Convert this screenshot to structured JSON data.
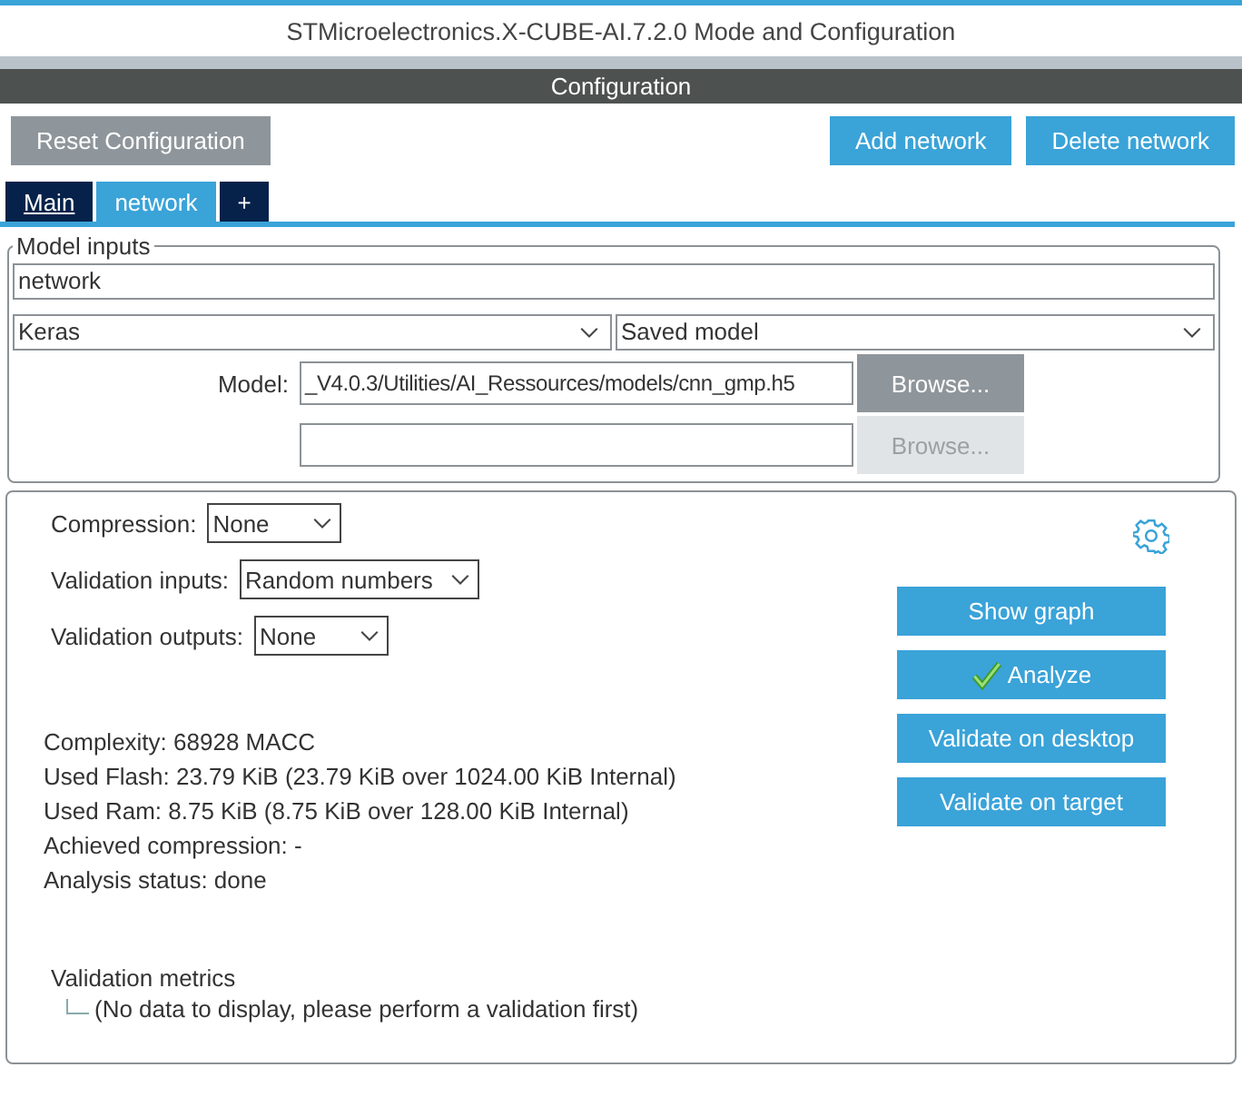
{
  "window": {
    "title": "STMicroelectronics.X-CUBE-AI.7.2.0 Mode and Configuration"
  },
  "header": {
    "title": "Configuration"
  },
  "toolbar": {
    "reset": {
      "label": "Reset Configuration",
      "disabled": true
    },
    "buttons": [
      "Add network",
      "Delete network"
    ]
  },
  "tabs": [
    {
      "label": "Main",
      "selected": false
    },
    {
      "label": "network",
      "selected": true
    },
    {
      "label": "+",
      "selected": false
    }
  ],
  "model_inputs": {
    "legend": "Model inputs",
    "name": "network",
    "framework": "Keras",
    "format": "Saved model",
    "model_label": "Model:",
    "files": [
      {
        "value": "_V4.0.3/Utilities/AI_Ressources/models/cnn_gmp.h5",
        "browse": "Browse...",
        "disabled": false
      },
      {
        "browse": "Browse...",
        "disabled": true
      }
    ]
  },
  "settings": [
    {
      "label": "Compression:",
      "value": "None"
    },
    {
      "label": "Validation inputs:",
      "value": "Random numbers"
    },
    {
      "label": "Validation outputs:",
      "value": "None"
    }
  ],
  "actions": [
    {
      "label": "Show graph",
      "checked": false
    },
    {
      "label": "Analyze",
      "checked": true
    },
    {
      "label": "Validate on desktop",
      "checked": false
    },
    {
      "label": "Validate on target",
      "checked": false
    }
  ],
  "results": [
    "Complexity:  68928 MACC",
    "Used Flash: 23.79 KiB (23.79 KiB over 1024.00 KiB Internal)",
    "Used Ram: 8.75 KiB (8.75 KiB over 128.00 KiB Internal)",
    "Achieved compression: -",
    "Analysis status: done"
  ],
  "validation_metrics": {
    "title": "Validation metrics",
    "children": [
      {
        "label": "(No data to display, please perform a validation first)"
      }
    ]
  }
}
